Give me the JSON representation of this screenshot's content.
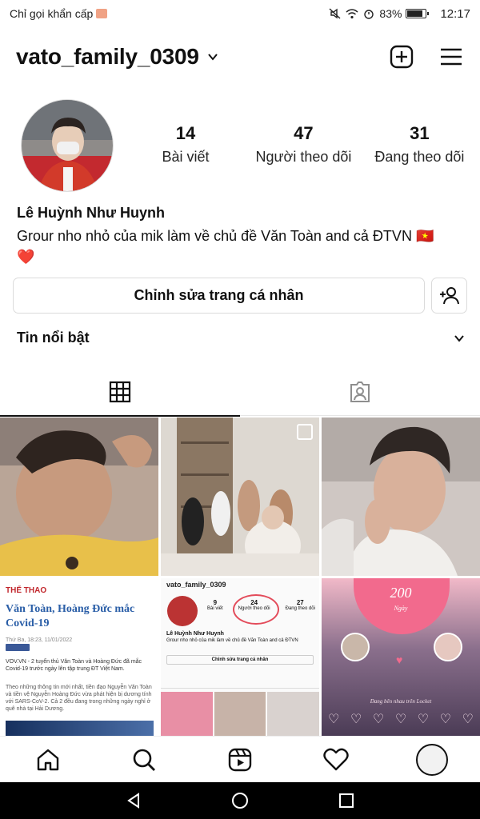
{
  "status_bar": {
    "carrier": "Chỉ gọi khẩn cấp",
    "battery_percent": "83%",
    "battery_level": 0.83,
    "time": "12:17"
  },
  "header": {
    "username": "vato_family_0309"
  },
  "profile": {
    "posts_count": "14",
    "posts_label": "Bài viết",
    "followers_count": "47",
    "followers_label": "Người theo dõi",
    "following_count": "31",
    "following_label": "Đang theo dõi",
    "full_name": "Lê Huỳnh Như Huynh",
    "bio_line1": "Grour nho nhỏ của mik làm về chủ đề Văn Toàn and cả ĐTVN 🇻🇳",
    "bio_line2": "❤️",
    "edit_button": "Chỉnh sửa trang cá nhân"
  },
  "highlights": {
    "title": "Tin nổi bật"
  },
  "tabs": [
    {
      "name": "grid",
      "icon": "grid-icon"
    },
    {
      "name": "tagged",
      "icon": "tagged-icon"
    }
  ],
  "grid": {
    "news": {
      "tag": "THỂ THAO",
      "title": "Văn Toàn, Hoàng Đức mắc Covid-19",
      "date": "Thứ Ba, 18:23, 11/01/2022",
      "body": "VOV.VN - 2 tuyển thủ Văn Toàn và Hoàng Đức đã mắc Covid-19 trước ngày lên tập trung ĐT Việt Nam.",
      "body2": "Theo những thông tin mới nhất, tiền đạo Nguyễn Văn Toàn và tiền vệ Nguyễn Hoàng Đức vừa phát hiện bị dương tính với SARS-CoV-2. Cả 2 đều đang trong những ngày nghỉ ở quê nhà tại Hải Dương."
    },
    "mini_profile": {
      "username": "vato_family_0309",
      "posts": "9",
      "posts_label": "Bài viết",
      "followers": "24",
      "followers_label": "Người theo dõi",
      "following": "27",
      "following_label": "Đang theo dõi",
      "name": "Lê Huỳnh Như Huynh",
      "bio": "Grour nho nhỏ của mik làm về chủ đề Văn Toàn and cả ĐTVN",
      "edit": "Chỉnh sửa trang cá nhân"
    },
    "pink": {
      "number": "200",
      "subtitle": "Ngày",
      "caption": "Đang bên nhau trên Locket"
    }
  },
  "colors": {
    "accent_red": "#ed4956",
    "text": "#111111",
    "border": "#dbdbdb"
  }
}
